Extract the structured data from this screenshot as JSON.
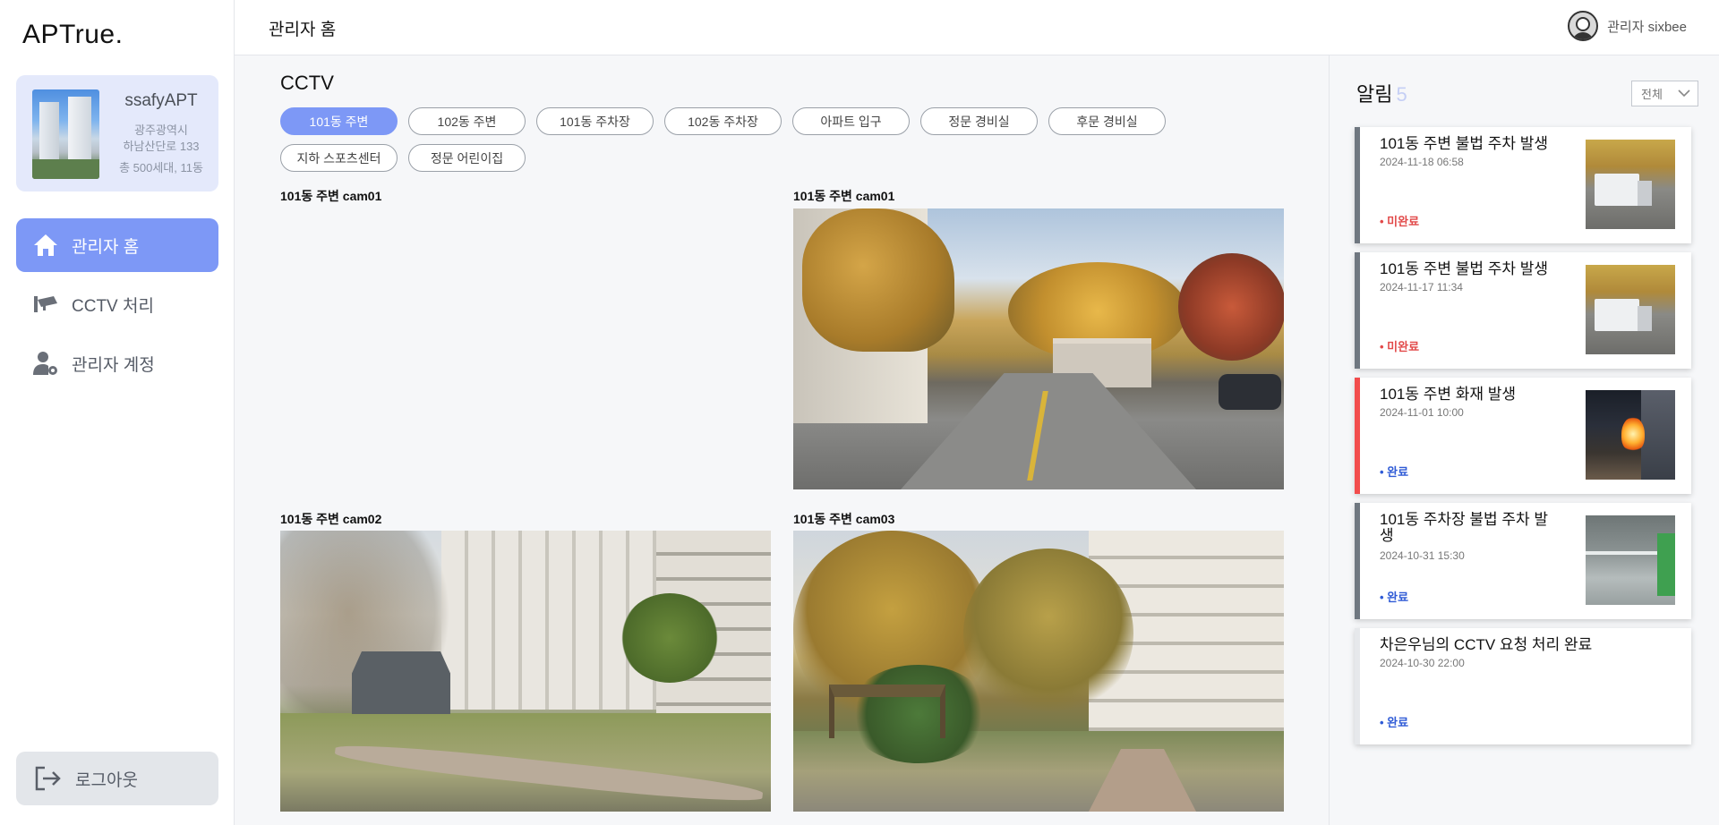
{
  "app": {
    "logo": "APTrue."
  },
  "apartment": {
    "name": "ssafyAPT",
    "city": "광주광역시",
    "address": "하남산단로 133",
    "summary": "총 500세대, 11동"
  },
  "sidebar": {
    "items": [
      {
        "label": "관리자 홈",
        "icon": "home-icon",
        "active": true
      },
      {
        "label": "CCTV 처리",
        "icon": "cctv-icon",
        "active": false
      },
      {
        "label": "관리자 계정",
        "icon": "user-gear-icon",
        "active": false
      }
    ],
    "logout_label": "로그아웃"
  },
  "header": {
    "title": "관리자 홈",
    "user_label": "관리자 sixbee"
  },
  "cctv": {
    "title": "CCTV",
    "tabs": [
      {
        "label": "101동 주변",
        "active": true
      },
      {
        "label": "102동 주변",
        "active": false
      },
      {
        "label": "101동 주차장",
        "active": false
      },
      {
        "label": "102동 주차장",
        "active": false
      },
      {
        "label": "아파트 입구",
        "active": false
      },
      {
        "label": "정문 경비실",
        "active": false
      },
      {
        "label": "후문 경비실",
        "active": false
      },
      {
        "label": "지하 스포츠센터",
        "active": false
      },
      {
        "label": "정문 어린이집",
        "active": false
      }
    ],
    "cams": [
      {
        "label": "101동 주변 cam01"
      },
      {
        "label": "101동 주변 cam01"
      },
      {
        "label": "101동 주변 cam02"
      },
      {
        "label": "101동 주변 cam03"
      }
    ]
  },
  "alerts": {
    "title": "알림",
    "count": "5",
    "filter": "전체",
    "items": [
      {
        "title": "101동 주변 불법 주차 발생",
        "date": "2024-11-18 06:58",
        "status": "• 미완료"
      },
      {
        "title": "101동 주변 불법 주차 발생",
        "date": "2024-11-17 11:34",
        "status": "• 미완료"
      },
      {
        "title": "101동 주변 화재 발생",
        "date": "2024-11-01 10:00",
        "status": "• 완료"
      },
      {
        "title": "101동 주차장 불법 주차 발생",
        "date": "2024-10-31 15:30",
        "status": "• 완료"
      },
      {
        "title": "차은우님의 CCTV 요청 처리 완료",
        "date": "2024-10-30 22:00",
        "status": "• 완료"
      }
    ]
  },
  "colors": {
    "accent": "#7d98f6",
    "apt_card_bg": "#e4e9fb",
    "status_done": "#2f5bd6",
    "status_todo": "#e24a4a",
    "card_border_gray": "#6f7780",
    "card_border_red": "#f24c4c"
  }
}
